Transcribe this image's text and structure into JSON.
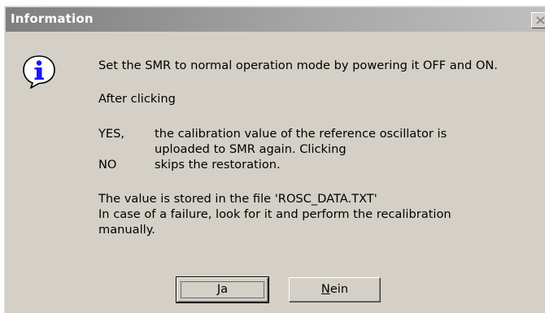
{
  "dialog": {
    "title": "Information",
    "icon": "info-icon",
    "colors": {
      "face": "#d4d0c8",
      "title_gradient_start": "#7f7f7f",
      "title_gradient_end": "#c0c0c0",
      "icon_blue": "#1818ff"
    },
    "message": {
      "line1": "Set the SMR to normal operation mode by powering it OFF and ON.",
      "line2": "After clicking",
      "yes_key": "YES,",
      "yes_text_1": "the calibration value of the reference oscillator is",
      "yes_text_2": "uploaded to SMR again. Clicking",
      "no_key": "NO",
      "no_text": "skips the restoration.",
      "stored": "The value is stored in the file 'ROSC_DATA.TXT'",
      "failure_1": "In case of a failure, look for it and perform the recalibration",
      "failure_2": "manually."
    },
    "buttons": {
      "yes": {
        "mnemonic": "J",
        "rest": "a"
      },
      "no": {
        "mnemonic": "N",
        "rest": "ein"
      }
    }
  }
}
